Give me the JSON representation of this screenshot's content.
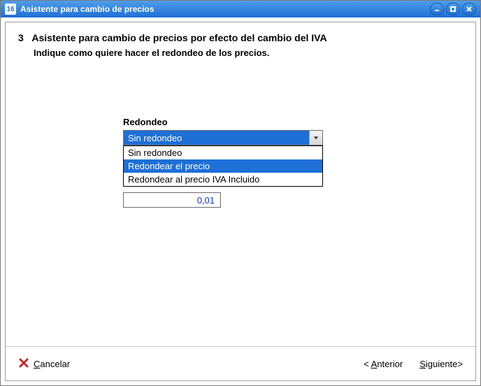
{
  "window": {
    "title": "Asistente para cambio de precios",
    "app_icon_text": "16"
  },
  "header": {
    "step_number": "3",
    "step_title": "Asistente para cambio de precios por efecto del cambio del IVA",
    "subtitle": "Indique como quiere hacer el redondeo de los precios."
  },
  "field": {
    "label": "Redondeo",
    "selected": "Sin redondeo",
    "options": [
      "Sin redondeo",
      "Redondear el precio",
      "Redondear al precio IVA Incluido"
    ],
    "highlight_index": 1,
    "small_value": "0,01"
  },
  "footer": {
    "cancel": "Cancelar",
    "back_prefix": "< ",
    "back": "Anterior",
    "next": "Siguiente",
    "next_suffix": ">"
  }
}
